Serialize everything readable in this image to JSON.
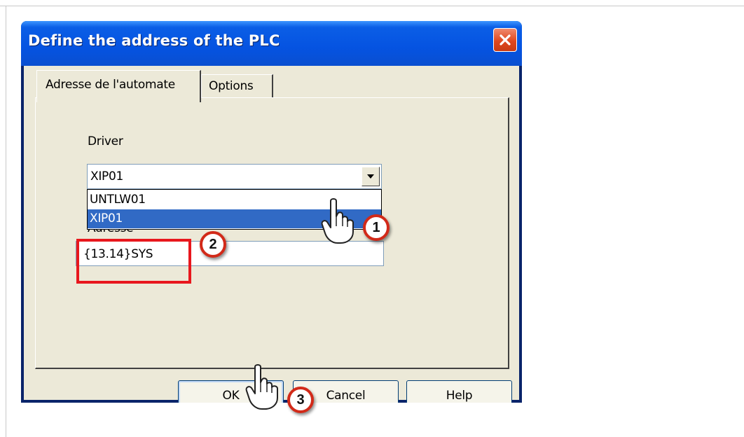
{
  "dialog": {
    "title": "Define the address of the PLC"
  },
  "tabs": [
    {
      "label": "Adresse de l'automate",
      "active": true
    },
    {
      "label": "Options",
      "active": false
    }
  ],
  "driver": {
    "label": "Driver",
    "selected": "XIP01",
    "options": [
      "UNTLW01",
      "XIP01"
    ]
  },
  "address": {
    "label": "Adresse",
    "value": "{13.14}SYS"
  },
  "buttons": {
    "ok": "OK",
    "cancel": "Cancel",
    "help": "Help"
  },
  "annotations": {
    "step1": "1",
    "step2": "2",
    "step3": "3",
    "highlight_color": "#e8171d"
  },
  "icons": [
    "close-icon",
    "dropdown-arrow-icon",
    "hand-cursor-icon"
  ]
}
